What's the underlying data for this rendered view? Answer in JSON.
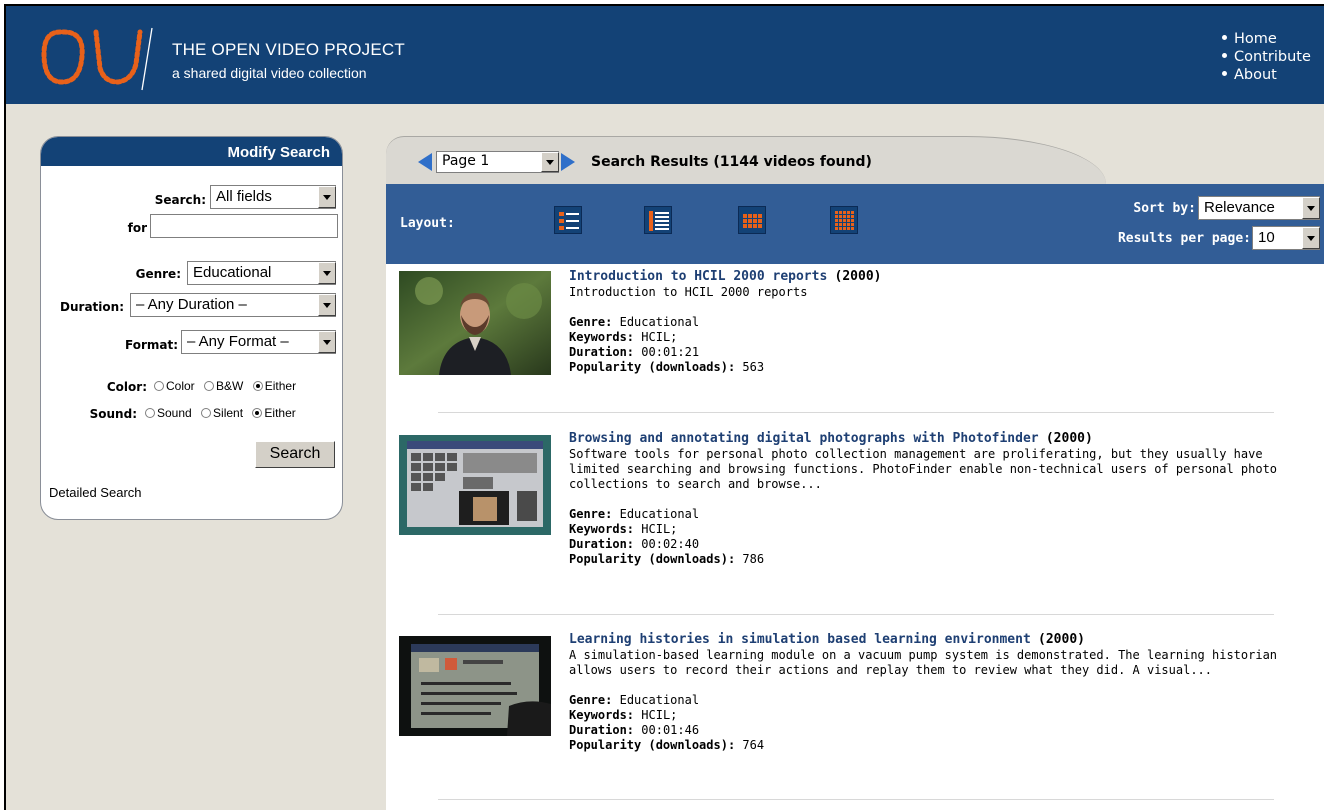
{
  "header": {
    "brand_title": "THE OPEN VIDEO PROJECT",
    "brand_subtitle": "a shared digital video collection",
    "nav": [
      "Home",
      "Contribute",
      "About"
    ]
  },
  "sidebar": {
    "heading": "Modify Search",
    "search_label": "Search:",
    "search_field_value": "All fields",
    "for_label": "for",
    "for_value": "",
    "genre_label": "Genre:",
    "genre_value": "Educational",
    "duration_label": "Duration:",
    "duration_value": "– Any Duration –",
    "format_label": "Format:",
    "format_value": "– Any Format –",
    "color_label": "Color:",
    "color_options": [
      "Color",
      "B&W",
      "Either"
    ],
    "sound_label": "Sound:",
    "sound_options": [
      "Sound",
      "Silent",
      "Either"
    ],
    "search_button": "Search",
    "detailed_search": "Detailed Search"
  },
  "results_header": {
    "page_value": "Page 1",
    "title": "Search Results (1144 videos found)",
    "layout_label": "Layout:",
    "sort_label": "Sort by:",
    "sort_value": "Relevance",
    "rpp_label": "Results per page:",
    "rpp_value": "10"
  },
  "labels": {
    "genre": "Genre:",
    "keywords": "Keywords:",
    "duration": "Duration:",
    "popularity": "Popularity (downloads):"
  },
  "results": [
    {
      "title": "Introduction to HCIL 2000 reports",
      "year": "(2000)",
      "description": "Introduction to HCIL 2000 reports",
      "genre": "Educational",
      "keywords": "HCIL;",
      "duration": "00:01:21",
      "popularity": "563"
    },
    {
      "title": "Browsing and annotating digital photographs with Photofinder",
      "year": "(2000)",
      "description": "Software tools for personal photo collection management are proliferating, but they usually have limited searching and browsing functions. PhotoFinder enable non-technical users of personal photo collections to search and browse...",
      "genre": "Educational",
      "keywords": "HCIL;",
      "duration": "00:02:40",
      "popularity": "786"
    },
    {
      "title": "Learning histories in simulation based learning environment",
      "year": "(2000)",
      "description": "A simulation-based learning module on a vacuum pump system is demonstrated. The learning historian allows users to record their actions and replay them to review what they did. A visual...",
      "genre": "Educational",
      "keywords": "HCIL;",
      "duration": "00:01:46",
      "popularity": "764"
    }
  ],
  "colors": {
    "header_bg": "#134276",
    "bar_bg": "#325d96",
    "logo_orange": "#e8611a",
    "title_link": "#1e3f73"
  }
}
